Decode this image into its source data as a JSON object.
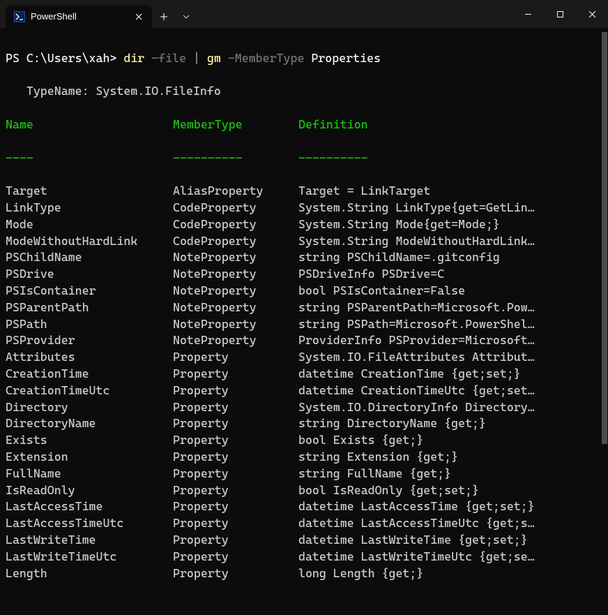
{
  "window": {
    "tab_title": "PowerShell"
  },
  "prompt": {
    "ps": "PS ",
    "path": "C:\\Users\\xah>",
    "cmd1": "dir",
    "flag1": "-file",
    "pipe": "|",
    "cmd2": "gm",
    "flag2": "-MemberType",
    "arg": "Properties"
  },
  "typename_label": "   TypeName: ",
  "typename_value": "System.IO.FileInfo",
  "headers": {
    "name": "Name",
    "name_u": "----",
    "type": "MemberType",
    "type_u": "----------",
    "def": "Definition",
    "def_u": "----------"
  },
  "rows": [
    {
      "name": "Target",
      "type": "AliasProperty",
      "def": "Target = LinkTarget",
      "trunc": false
    },
    {
      "name": "LinkType",
      "type": "CodeProperty",
      "def": "System.String LinkType{get=GetLin",
      "trunc": true
    },
    {
      "name": "Mode",
      "type": "CodeProperty",
      "def": "System.String Mode{get=Mode;}",
      "trunc": false
    },
    {
      "name": "ModeWithoutHardLink",
      "type": "CodeProperty",
      "def": "System.String ModeWithoutHardLink",
      "trunc": true
    },
    {
      "name": "PSChildName",
      "type": "NoteProperty",
      "def": "string PSChildName=.gitconfig",
      "trunc": false
    },
    {
      "name": "PSDrive",
      "type": "NoteProperty",
      "def": "PSDriveInfo PSDrive=C",
      "trunc": false
    },
    {
      "name": "PSIsContainer",
      "type": "NoteProperty",
      "def": "bool PSIsContainer=False",
      "trunc": false
    },
    {
      "name": "PSParentPath",
      "type": "NoteProperty",
      "def": "string PSParentPath=Microsoft.Pow",
      "trunc": true
    },
    {
      "name": "PSPath",
      "type": "NoteProperty",
      "def": "string PSPath=Microsoft.PowerShel",
      "trunc": true
    },
    {
      "name": "PSProvider",
      "type": "NoteProperty",
      "def": "ProviderInfo PSProvider=Microsoft",
      "trunc": true
    },
    {
      "name": "Attributes",
      "type": "Property",
      "def": "System.IO.FileAttributes Attribut",
      "trunc": true
    },
    {
      "name": "CreationTime",
      "type": "Property",
      "def": "datetime CreationTime {get;set;}",
      "trunc": false
    },
    {
      "name": "CreationTimeUtc",
      "type": "Property",
      "def": "datetime CreationTimeUtc {get;set",
      "trunc": true
    },
    {
      "name": "Directory",
      "type": "Property",
      "def": "System.IO.DirectoryInfo Directory",
      "trunc": true
    },
    {
      "name": "DirectoryName",
      "type": "Property",
      "def": "string DirectoryName {get;}",
      "trunc": false
    },
    {
      "name": "Exists",
      "type": "Property",
      "def": "bool Exists {get;}",
      "trunc": false
    },
    {
      "name": "Extension",
      "type": "Property",
      "def": "string Extension {get;}",
      "trunc": false
    },
    {
      "name": "FullName",
      "type": "Property",
      "def": "string FullName {get;}",
      "trunc": false
    },
    {
      "name": "IsReadOnly",
      "type": "Property",
      "def": "bool IsReadOnly {get;set;}",
      "trunc": false
    },
    {
      "name": "LastAccessTime",
      "type": "Property",
      "def": "datetime LastAccessTime {get;set;}",
      "trunc": false
    },
    {
      "name": "LastAccessTimeUtc",
      "type": "Property",
      "def": "datetime LastAccessTimeUtc {get;s",
      "trunc": true
    },
    {
      "name": "LastWriteTime",
      "type": "Property",
      "def": "datetime LastWriteTime {get;set;}",
      "trunc": false
    },
    {
      "name": "LastWriteTimeUtc",
      "type": "Property",
      "def": "datetime LastWriteTimeUtc {get;se",
      "trunc": true
    },
    {
      "name": "Length",
      "type": "Property",
      "def": "long Length {get;}",
      "trunc": false
    }
  ]
}
